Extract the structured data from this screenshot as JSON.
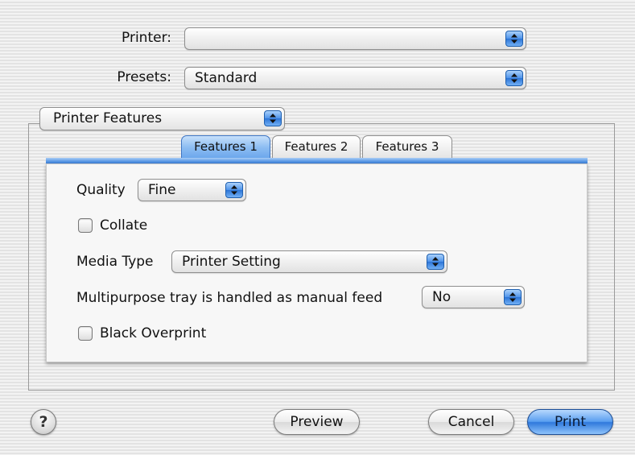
{
  "printer": {
    "label": "Printer:",
    "value": ""
  },
  "presets": {
    "label": "Presets:",
    "value": "Standard"
  },
  "section_popup": {
    "value": "Printer Features"
  },
  "tabs": [
    {
      "label": "Features 1",
      "active": true
    },
    {
      "label": "Features 2",
      "active": false
    },
    {
      "label": "Features 3",
      "active": false
    }
  ],
  "features": {
    "quality": {
      "label": "Quality",
      "value": "Fine"
    },
    "collate": {
      "label": "Collate",
      "checked": false
    },
    "media_type": {
      "label": "Media Type",
      "value": "Printer Setting"
    },
    "multipurpose": {
      "label": "Multipurpose tray is handled as manual feed",
      "value": "No"
    },
    "black_overprint": {
      "label": "Black Overprint",
      "checked": false
    }
  },
  "buttons": {
    "help": "?",
    "preview": "Preview",
    "cancel": "Cancel",
    "print": "Print"
  },
  "colors": {
    "accent": "#3c7fd8",
    "default_button": "#2f78dc"
  }
}
